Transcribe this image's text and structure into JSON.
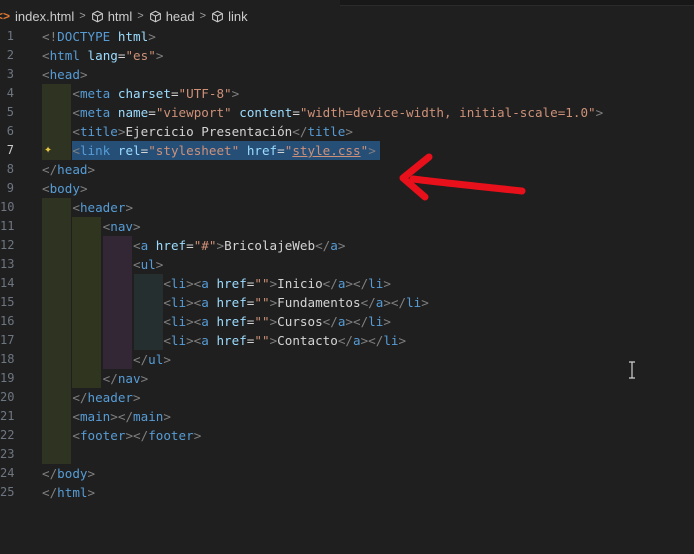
{
  "breadcrumb": {
    "file": "index.html",
    "items": [
      "html",
      "head",
      "link"
    ],
    "sep": ">"
  },
  "editor": {
    "active_line": 7,
    "lines": [
      {
        "n": "1",
        "t": [
          [
            "p",
            "<!"
          ],
          [
            "t",
            "DOCTYPE"
          ],
          [
            "x",
            " "
          ],
          [
            "a",
            "html"
          ],
          [
            "p",
            ">"
          ]
        ]
      },
      {
        "n": "2",
        "t": [
          [
            "p",
            "<"
          ],
          [
            "t",
            "html"
          ],
          [
            "x",
            " "
          ],
          [
            "a",
            "lang"
          ],
          [
            "x",
            "="
          ],
          [
            "s",
            "\"es\""
          ],
          [
            "p",
            ">"
          ]
        ]
      },
      {
        "n": "3",
        "t": [
          [
            "p",
            "<"
          ],
          [
            "t",
            "head"
          ],
          [
            "p",
            ">"
          ]
        ]
      },
      {
        "n": "4",
        "t": [
          [
            "x",
            "    "
          ],
          [
            "p",
            "<"
          ],
          [
            "t",
            "meta"
          ],
          [
            "x",
            " "
          ],
          [
            "a",
            "charset"
          ],
          [
            "x",
            "="
          ],
          [
            "s",
            "\"UTF-8\""
          ],
          [
            "p",
            ">"
          ]
        ]
      },
      {
        "n": "5",
        "t": [
          [
            "x",
            "    "
          ],
          [
            "p",
            "<"
          ],
          [
            "t",
            "meta"
          ],
          [
            "x",
            " "
          ],
          [
            "a",
            "name"
          ],
          [
            "x",
            "="
          ],
          [
            "s",
            "\"viewport\""
          ],
          [
            "x",
            " "
          ],
          [
            "a",
            "content"
          ],
          [
            "x",
            "="
          ],
          [
            "s",
            "\"width=device-width, initial-scale=1.0\""
          ],
          [
            "p",
            ">"
          ]
        ]
      },
      {
        "n": "6",
        "t": [
          [
            "x",
            "    "
          ],
          [
            "p",
            "<"
          ],
          [
            "t",
            "title"
          ],
          [
            "p",
            ">"
          ],
          [
            "x",
            "Ejercicio Presentación"
          ],
          [
            "p",
            "</"
          ],
          [
            "t",
            "title"
          ],
          [
            "p",
            ">"
          ]
        ]
      },
      {
        "n": "7",
        "t": [
          [
            "x",
            "    "
          ],
          [
            "p",
            "<"
          ],
          [
            "t",
            "link"
          ],
          [
            "x",
            " "
          ],
          [
            "a",
            "rel"
          ],
          [
            "x",
            "="
          ],
          [
            "s",
            "\"stylesheet\""
          ],
          [
            "x",
            " "
          ],
          [
            "a",
            "href"
          ],
          [
            "x",
            "="
          ],
          [
            "s",
            "\""
          ],
          [
            "su",
            "style.css"
          ],
          [
            "s",
            "\""
          ],
          [
            "p",
            ">"
          ]
        ]
      },
      {
        "n": "8",
        "t": [
          [
            "p",
            "</"
          ],
          [
            "t",
            "head"
          ],
          [
            "p",
            ">"
          ]
        ]
      },
      {
        "n": "9",
        "t": [
          [
            "p",
            "<"
          ],
          [
            "t",
            "body"
          ],
          [
            "p",
            ">"
          ]
        ]
      },
      {
        "n": "10",
        "t": [
          [
            "x",
            "    "
          ],
          [
            "p",
            "<"
          ],
          [
            "t",
            "header"
          ],
          [
            "p",
            ">"
          ]
        ]
      },
      {
        "n": "11",
        "t": [
          [
            "x",
            "        "
          ],
          [
            "p",
            "<"
          ],
          [
            "t",
            "nav"
          ],
          [
            "p",
            ">"
          ]
        ]
      },
      {
        "n": "12",
        "t": [
          [
            "x",
            "            "
          ],
          [
            "p",
            "<"
          ],
          [
            "t",
            "a"
          ],
          [
            "x",
            " "
          ],
          [
            "a",
            "href"
          ],
          [
            "x",
            "="
          ],
          [
            "s",
            "\"#\""
          ],
          [
            "p",
            ">"
          ],
          [
            "x",
            "BricolajeWeb"
          ],
          [
            "p",
            "</"
          ],
          [
            "t",
            "a"
          ],
          [
            "p",
            ">"
          ]
        ]
      },
      {
        "n": "13",
        "t": [
          [
            "x",
            "            "
          ],
          [
            "p",
            "<"
          ],
          [
            "t",
            "ul"
          ],
          [
            "p",
            ">"
          ]
        ]
      },
      {
        "n": "14",
        "t": [
          [
            "x",
            "                "
          ],
          [
            "p",
            "<"
          ],
          [
            "t",
            "li"
          ],
          [
            "p",
            "><"
          ],
          [
            "t",
            "a"
          ],
          [
            "x",
            " "
          ],
          [
            "a",
            "href"
          ],
          [
            "x",
            "="
          ],
          [
            "s",
            "\"\""
          ],
          [
            "p",
            ">"
          ],
          [
            "x",
            "Inicio"
          ],
          [
            "p",
            "</"
          ],
          [
            "t",
            "a"
          ],
          [
            "p",
            "></"
          ],
          [
            "t",
            "li"
          ],
          [
            "p",
            ">"
          ]
        ]
      },
      {
        "n": "15",
        "t": [
          [
            "x",
            "                "
          ],
          [
            "p",
            "<"
          ],
          [
            "t",
            "li"
          ],
          [
            "p",
            "><"
          ],
          [
            "t",
            "a"
          ],
          [
            "x",
            " "
          ],
          [
            "a",
            "href"
          ],
          [
            "x",
            "="
          ],
          [
            "s",
            "\"\""
          ],
          [
            "p",
            ">"
          ],
          [
            "x",
            "Fundamentos"
          ],
          [
            "p",
            "</"
          ],
          [
            "t",
            "a"
          ],
          [
            "p",
            "></"
          ],
          [
            "t",
            "li"
          ],
          [
            "p",
            ">"
          ]
        ]
      },
      {
        "n": "16",
        "t": [
          [
            "x",
            "                "
          ],
          [
            "p",
            "<"
          ],
          [
            "t",
            "li"
          ],
          [
            "p",
            "><"
          ],
          [
            "t",
            "a"
          ],
          [
            "x",
            " "
          ],
          [
            "a",
            "href"
          ],
          [
            "x",
            "="
          ],
          [
            "s",
            "\"\""
          ],
          [
            "p",
            ">"
          ],
          [
            "x",
            "Cursos"
          ],
          [
            "p",
            "</"
          ],
          [
            "t",
            "a"
          ],
          [
            "p",
            "></"
          ],
          [
            "t",
            "li"
          ],
          [
            "p",
            ">"
          ]
        ]
      },
      {
        "n": "17",
        "t": [
          [
            "x",
            "                "
          ],
          [
            "p",
            "<"
          ],
          [
            "t",
            "li"
          ],
          [
            "p",
            "><"
          ],
          [
            "t",
            "a"
          ],
          [
            "x",
            " "
          ],
          [
            "a",
            "href"
          ],
          [
            "x",
            "="
          ],
          [
            "s",
            "\"\""
          ],
          [
            "p",
            ">"
          ],
          [
            "x",
            "Contacto"
          ],
          [
            "p",
            "</"
          ],
          [
            "t",
            "a"
          ],
          [
            "p",
            "></"
          ],
          [
            "t",
            "li"
          ],
          [
            "p",
            ">"
          ]
        ]
      },
      {
        "n": "18",
        "t": [
          [
            "x",
            "            "
          ],
          [
            "p",
            "</"
          ],
          [
            "t",
            "ul"
          ],
          [
            "p",
            ">"
          ]
        ]
      },
      {
        "n": "19",
        "t": [
          [
            "x",
            "        "
          ],
          [
            "p",
            "</"
          ],
          [
            "t",
            "nav"
          ],
          [
            "p",
            ">"
          ]
        ]
      },
      {
        "n": "20",
        "t": [
          [
            "x",
            "    "
          ],
          [
            "p",
            "</"
          ],
          [
            "t",
            "header"
          ],
          [
            "p",
            ">"
          ]
        ]
      },
      {
        "n": "21",
        "t": [
          [
            "x",
            "    "
          ],
          [
            "p",
            "<"
          ],
          [
            "t",
            "main"
          ],
          [
            "p",
            "></"
          ],
          [
            "t",
            "main"
          ],
          [
            "p",
            ">"
          ]
        ]
      },
      {
        "n": "22",
        "t": [
          [
            "x",
            "    "
          ],
          [
            "p",
            "<"
          ],
          [
            "t",
            "footer"
          ],
          [
            "p",
            "></"
          ],
          [
            "t",
            "footer"
          ],
          [
            "p",
            ">"
          ]
        ]
      },
      {
        "n": "23",
        "t": []
      },
      {
        "n": "24",
        "t": [
          [
            "p",
            "</"
          ],
          [
            "t",
            "body"
          ],
          [
            "p",
            ">"
          ]
        ]
      },
      {
        "n": "25",
        "t": [
          [
            "p",
            "</"
          ],
          [
            "t",
            "html"
          ],
          [
            "p",
            ">"
          ]
        ]
      }
    ]
  },
  "colors": {
    "background": "#1f1f1f",
    "tag": "#569cd6",
    "attribute": "#9cdcfe",
    "string": "#ce9178",
    "punctuation": "#808080",
    "selection": "#264f78",
    "annotation_arrow": "#e8101a"
  },
  "icons": {
    "file": "html-file-icon",
    "symbol": "code-symbol-icon",
    "lightbulb": "sparkle-lightbulb-icon",
    "cursor": "text-cursor-icon"
  }
}
